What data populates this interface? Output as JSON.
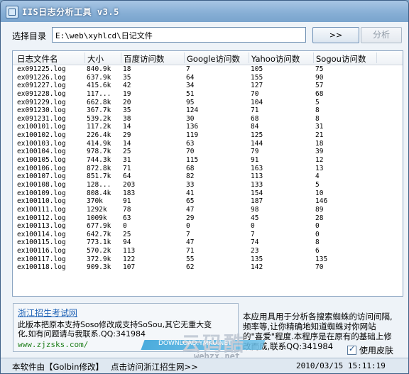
{
  "window": {
    "title": "IIS日志分析工具 v3.5"
  },
  "toolbar": {
    "dir_label": "选择目录",
    "dir_value": "E:\\web\\xyhlcd\\日记文件",
    "browse_label": ">>",
    "analyze_label": "分析"
  },
  "table": {
    "columns": [
      "日志文件名",
      "大小",
      "百度访问数",
      "Google访问数",
      "Yahoo访问数",
      "Sogou访问数"
    ],
    "rows": [
      [
        "ex091225.log",
        "840.9k",
        "18",
        "7",
        "105",
        "75"
      ],
      [
        "ex091226.log",
        "637.9k",
        "35",
        "64",
        "155",
        "90"
      ],
      [
        "ex091227.log",
        "415.6k",
        "42",
        "34",
        "127",
        "57"
      ],
      [
        "ex091228.log",
        "117...",
        "19",
        "51",
        "70",
        "68"
      ],
      [
        "ex091229.log",
        "662.8k",
        "20",
        "95",
        "104",
        "5"
      ],
      [
        "ex091230.log",
        "367.7k",
        "35",
        "124",
        "71",
        "8"
      ],
      [
        "ex091231.log",
        "539.2k",
        "38",
        "30",
        "68",
        "8"
      ],
      [
        "ex100101.log",
        "117.2k",
        "14",
        "136",
        "84",
        "31"
      ],
      [
        "ex100102.log",
        "226.4k",
        "29",
        "119",
        "125",
        "21"
      ],
      [
        "ex100103.log",
        "414.9k",
        "14",
        "63",
        "144",
        "18"
      ],
      [
        "ex100104.log",
        "978.7k",
        "25",
        "70",
        "79",
        "39"
      ],
      [
        "ex100105.log",
        "744.3k",
        "31",
        "115",
        "91",
        "12"
      ],
      [
        "ex100106.log",
        "872.8k",
        "71",
        "68",
        "163",
        "13"
      ],
      [
        "ex100107.log",
        "851.7k",
        "64",
        "82",
        "113",
        "4"
      ],
      [
        "ex100108.log",
        "128...",
        "203",
        "33",
        "133",
        "5"
      ],
      [
        "ex100109.log",
        "808.4k",
        "183",
        "41",
        "154",
        "10"
      ],
      [
        "ex100110.log",
        "370k",
        "91",
        "65",
        "187",
        "146"
      ],
      [
        "ex100111.log",
        "1292k",
        "78",
        "47",
        "98",
        "89"
      ],
      [
        "ex100112.log",
        "1009k",
        "63",
        "29",
        "45",
        "28"
      ],
      [
        "ex100113.log",
        "677.9k",
        "0",
        "0",
        "0",
        "0"
      ],
      [
        "ex100114.log",
        "642.7k",
        "25",
        "7",
        "7",
        "0"
      ],
      [
        "ex100115.log",
        "773.1k",
        "94",
        "47",
        "74",
        "8"
      ],
      [
        "ex100116.log",
        "570.2k",
        "113",
        "71",
        "23",
        "6"
      ],
      [
        "ex100117.log",
        "372.9k",
        "122",
        "55",
        "135",
        "135"
      ],
      [
        "ex100118.log",
        "909.3k",
        "107",
        "62",
        "142",
        "70"
      ]
    ]
  },
  "ad": {
    "title": "浙江招生考试网",
    "line1": "此版本把原本支持Soso修改成支持SoSou,其它无重大变",
    "line2": "化,如有问题请与我联系.QQ:341984",
    "url": "www.zjzsks.com/"
  },
  "info": {
    "text": "本应用具用于分析各搜索蜘蛛的访问间隔,频率等,让你精确地知道蜘蛛对你网站的\"喜爱\"程度.本程序是在原有的基础上修改而成,联系QQ:341984"
  },
  "skin": {
    "label": "使用皮肤",
    "checked": true
  },
  "status": {
    "left": "本软件由【Golbin修改】",
    "link": "点击访问浙江招生网>>",
    "time": "2010/03/15 15:11:19"
  },
  "watermark": {
    "main": "云码酷",
    "sub": "DOWNLOAD.YMKU.NET",
    "url": "webzx.net"
  }
}
